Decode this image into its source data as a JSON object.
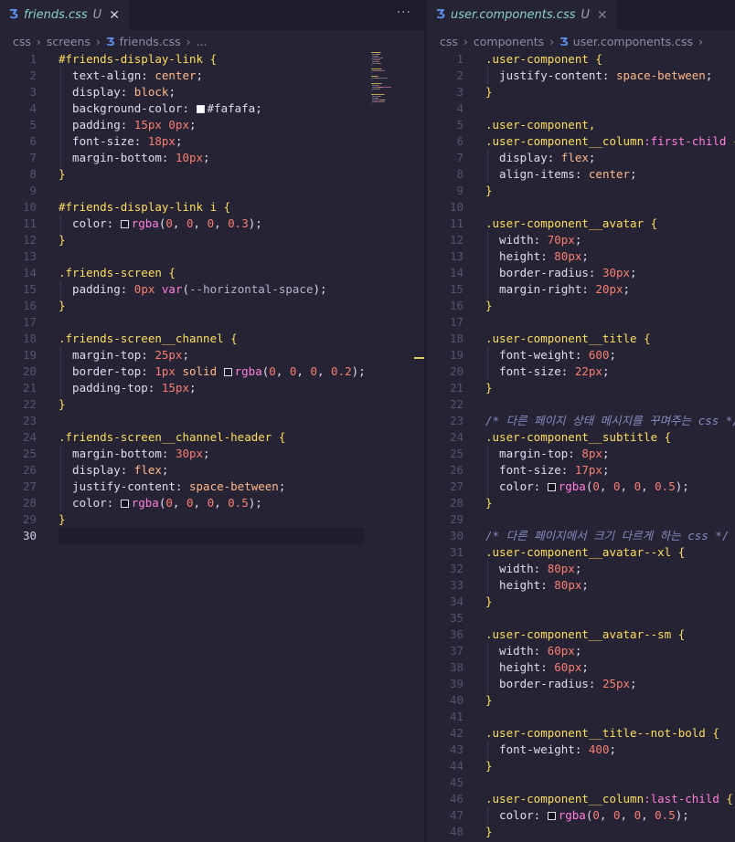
{
  "left": {
    "tab": {
      "filename": "friends.css",
      "status": "U"
    },
    "more_label": "···",
    "breadcrumb": [
      "css",
      "screens",
      "friends.css",
      "..."
    ],
    "current_line": 30,
    "lines": [
      [
        [
          "sel",
          "#friends-display-link "
        ],
        [
          "brace",
          "{"
        ]
      ],
      [
        [
          "prop",
          "  text-align: "
        ],
        [
          "kw",
          "center"
        ],
        [
          "punc",
          ";"
        ]
      ],
      [
        [
          "prop",
          "  display: "
        ],
        [
          "kw",
          "block"
        ],
        [
          "punc",
          ";"
        ]
      ],
      [
        [
          "prop",
          "  background-color: "
        ],
        [
          "swatch",
          "#fafafa"
        ],
        [
          "hash",
          "#fafafa"
        ],
        [
          "punc",
          ";"
        ]
      ],
      [
        [
          "prop",
          "  padding: "
        ],
        [
          "num",
          "15px 0px"
        ],
        [
          "punc",
          ";"
        ]
      ],
      [
        [
          "prop",
          "  font-size: "
        ],
        [
          "num",
          "18px"
        ],
        [
          "punc",
          ";"
        ]
      ],
      [
        [
          "prop",
          "  margin-bottom: "
        ],
        [
          "num",
          "10px"
        ],
        [
          "punc",
          ";"
        ]
      ],
      [
        [
          "brace",
          "}"
        ]
      ],
      [],
      [
        [
          "sel",
          "#friends-display-link i "
        ],
        [
          "brace",
          "{"
        ]
      ],
      [
        [
          "prop",
          "  color: "
        ],
        [
          "swatch",
          "rgba(0,0,0,0.3)"
        ],
        [
          "fnv",
          "rgba"
        ],
        [
          "punc",
          "("
        ],
        [
          "num",
          "0"
        ],
        [
          "punc",
          ", "
        ],
        [
          "num",
          "0"
        ],
        [
          "punc",
          ", "
        ],
        [
          "num",
          "0"
        ],
        [
          "punc",
          ", "
        ],
        [
          "num",
          "0.3"
        ],
        [
          "punc",
          ");"
        ]
      ],
      [
        [
          "brace",
          "}"
        ]
      ],
      [],
      [
        [
          "sel",
          ".friends-screen "
        ],
        [
          "brace",
          "{"
        ]
      ],
      [
        [
          "prop",
          "  padding: "
        ],
        [
          "num",
          "0px "
        ],
        [
          "fnv",
          "var"
        ],
        [
          "punc",
          "("
        ],
        [
          "var",
          "--horizontal-space"
        ],
        [
          "punc",
          ");"
        ]
      ],
      [
        [
          "brace",
          "}"
        ]
      ],
      [],
      [
        [
          "sel",
          ".friends-screen__channel "
        ],
        [
          "brace",
          "{"
        ]
      ],
      [
        [
          "prop",
          "  margin-top: "
        ],
        [
          "num",
          "25px"
        ],
        [
          "punc",
          ";"
        ]
      ],
      [
        [
          "prop",
          "  border-top: "
        ],
        [
          "num",
          "1px "
        ],
        [
          "kw",
          "solid "
        ],
        [
          "swatch",
          "rgba(0,0,0,0.2)"
        ],
        [
          "fnv",
          "rgba"
        ],
        [
          "punc",
          "("
        ],
        [
          "num",
          "0"
        ],
        [
          "punc",
          ", "
        ],
        [
          "num",
          "0"
        ],
        [
          "punc",
          ", "
        ],
        [
          "num",
          "0"
        ],
        [
          "punc",
          ", "
        ],
        [
          "num",
          "0.2"
        ],
        [
          "punc",
          ");"
        ]
      ],
      [
        [
          "prop",
          "  padding-top: "
        ],
        [
          "num",
          "15px"
        ],
        [
          "punc",
          ";"
        ]
      ],
      [
        [
          "brace",
          "}"
        ]
      ],
      [],
      [
        [
          "sel",
          ".friends-screen__channel-header "
        ],
        [
          "brace",
          "{"
        ]
      ],
      [
        [
          "prop",
          "  margin-bottom: "
        ],
        [
          "num",
          "30px"
        ],
        [
          "punc",
          ";"
        ]
      ],
      [
        [
          "prop",
          "  display: "
        ],
        [
          "kw",
          "flex"
        ],
        [
          "punc",
          ";"
        ]
      ],
      [
        [
          "prop",
          "  justify-content: "
        ],
        [
          "kw",
          "space-between"
        ],
        [
          "punc",
          ";"
        ]
      ],
      [
        [
          "prop",
          "  color: "
        ],
        [
          "swatch",
          "rgba(0,0,0,0.5)"
        ],
        [
          "fnv",
          "rgba"
        ],
        [
          "punc",
          "("
        ],
        [
          "num",
          "0"
        ],
        [
          "punc",
          ", "
        ],
        [
          "num",
          "0"
        ],
        [
          "punc",
          ", "
        ],
        [
          "num",
          "0"
        ],
        [
          "punc",
          ", "
        ],
        [
          "num",
          "0.5"
        ],
        [
          "punc",
          ");"
        ]
      ],
      [
        [
          "brace",
          "}"
        ]
      ],
      []
    ]
  },
  "right": {
    "tab": {
      "filename": "user.components.css",
      "status": "U"
    },
    "breadcrumb": [
      "css",
      "components",
      "user.components.css",
      ""
    ],
    "lines": [
      [
        [
          "sel",
          ".user-component "
        ],
        [
          "brace",
          "{"
        ]
      ],
      [
        [
          "prop",
          "  justify-content: "
        ],
        [
          "kw",
          "space-between"
        ],
        [
          "punc",
          ";"
        ]
      ],
      [
        [
          "brace",
          "}"
        ]
      ],
      [],
      [
        [
          "sel",
          ".user-component,"
        ]
      ],
      [
        [
          "sel",
          ".user-component__column"
        ],
        [
          "pseudo",
          ":first-child "
        ],
        [
          "brace",
          "{"
        ]
      ],
      [
        [
          "prop",
          "  display: "
        ],
        [
          "kw",
          "flex"
        ],
        [
          "punc",
          ";"
        ]
      ],
      [
        [
          "prop",
          "  align-items: "
        ],
        [
          "kw",
          "center"
        ],
        [
          "punc",
          ";"
        ]
      ],
      [
        [
          "brace",
          "}"
        ]
      ],
      [],
      [
        [
          "sel",
          ".user-component__avatar "
        ],
        [
          "brace",
          "{"
        ]
      ],
      [
        [
          "prop",
          "  width: "
        ],
        [
          "num",
          "70px"
        ],
        [
          "punc",
          ";"
        ]
      ],
      [
        [
          "prop",
          "  height: "
        ],
        [
          "num",
          "80px"
        ],
        [
          "punc",
          ";"
        ]
      ],
      [
        [
          "prop",
          "  border-radius: "
        ],
        [
          "num",
          "30px"
        ],
        [
          "punc",
          ";"
        ]
      ],
      [
        [
          "prop",
          "  margin-right: "
        ],
        [
          "num",
          "20px"
        ],
        [
          "punc",
          ";"
        ]
      ],
      [
        [
          "brace",
          "}"
        ]
      ],
      [],
      [
        [
          "sel",
          ".user-component__title "
        ],
        [
          "brace",
          "{"
        ]
      ],
      [
        [
          "prop",
          "  font-weight: "
        ],
        [
          "num",
          "600"
        ],
        [
          "punc",
          ";"
        ]
      ],
      [
        [
          "prop",
          "  font-size: "
        ],
        [
          "num",
          "22px"
        ],
        [
          "punc",
          ";"
        ]
      ],
      [
        [
          "brace",
          "}"
        ]
      ],
      [],
      [
        [
          "cmt",
          "/* 다른 페이지 상태 메시지를 꾸며주는 css */"
        ]
      ],
      [
        [
          "sel",
          ".user-component__subtitle "
        ],
        [
          "brace",
          "{"
        ]
      ],
      [
        [
          "prop",
          "  margin-top: "
        ],
        [
          "num",
          "8px"
        ],
        [
          "punc",
          ";"
        ]
      ],
      [
        [
          "prop",
          "  font-size: "
        ],
        [
          "num",
          "17px"
        ],
        [
          "punc",
          ";"
        ]
      ],
      [
        [
          "prop",
          "  color: "
        ],
        [
          "swatch",
          "rgba(0,0,0,0.5)"
        ],
        [
          "fnv",
          "rgba"
        ],
        [
          "punc",
          "("
        ],
        [
          "num",
          "0"
        ],
        [
          "punc",
          ", "
        ],
        [
          "num",
          "0"
        ],
        [
          "punc",
          ", "
        ],
        [
          "num",
          "0"
        ],
        [
          "punc",
          ", "
        ],
        [
          "num",
          "0.5"
        ],
        [
          "punc",
          ");"
        ]
      ],
      [
        [
          "brace",
          "}"
        ]
      ],
      [],
      [
        [
          "cmt",
          "/* 다른 페이지에서 크기 다르게 하는 css */"
        ]
      ],
      [
        [
          "sel",
          ".user-component__avatar--xl "
        ],
        [
          "brace",
          "{"
        ]
      ],
      [
        [
          "prop",
          "  width: "
        ],
        [
          "num",
          "80px"
        ],
        [
          "punc",
          ";"
        ]
      ],
      [
        [
          "prop",
          "  height: "
        ],
        [
          "num",
          "80px"
        ],
        [
          "punc",
          ";"
        ]
      ],
      [
        [
          "brace",
          "}"
        ]
      ],
      [],
      [
        [
          "sel",
          ".user-component__avatar--sm "
        ],
        [
          "brace",
          "{"
        ]
      ],
      [
        [
          "prop",
          "  width: "
        ],
        [
          "num",
          "60px"
        ],
        [
          "punc",
          ";"
        ]
      ],
      [
        [
          "prop",
          "  height: "
        ],
        [
          "num",
          "60px"
        ],
        [
          "punc",
          ";"
        ]
      ],
      [
        [
          "prop",
          "  border-radius: "
        ],
        [
          "num",
          "25px"
        ],
        [
          "punc",
          ";"
        ]
      ],
      [
        [
          "brace",
          "}"
        ]
      ],
      [],
      [
        [
          "sel",
          ".user-component__title--not-bold "
        ],
        [
          "brace",
          "{"
        ]
      ],
      [
        [
          "prop",
          "  font-weight: "
        ],
        [
          "num",
          "400"
        ],
        [
          "punc",
          ";"
        ]
      ],
      [
        [
          "brace",
          "}"
        ]
      ],
      [],
      [
        [
          "sel",
          ".user-component__column"
        ],
        [
          "pseudo",
          ":last-child "
        ],
        [
          "brace",
          "{"
        ]
      ],
      [
        [
          "prop",
          "  color: "
        ],
        [
          "swatch",
          "rgba(0,0,0,0.5)"
        ],
        [
          "fnv",
          "rgba"
        ],
        [
          "punc",
          "("
        ],
        [
          "num",
          "0"
        ],
        [
          "punc",
          ", "
        ],
        [
          "num",
          "0"
        ],
        [
          "punc",
          ", "
        ],
        [
          "num",
          "0"
        ],
        [
          "punc",
          ", "
        ],
        [
          "num",
          "0.5"
        ],
        [
          "punc",
          ");"
        ]
      ],
      [
        [
          "brace",
          "}"
        ]
      ]
    ]
  },
  "colors": {
    "background": "#262335",
    "selector": "#fede5d",
    "number": "#f97e72",
    "keyword": "#ffb98a",
    "function": "#ff7edb",
    "comment": "#848bbd",
    "css_icon": "#5d8ee8"
  },
  "icons": {
    "file": "css-file-icon",
    "close": "close-icon",
    "more": "more-actions-icon",
    "chevron": "chevron-right-icon"
  }
}
